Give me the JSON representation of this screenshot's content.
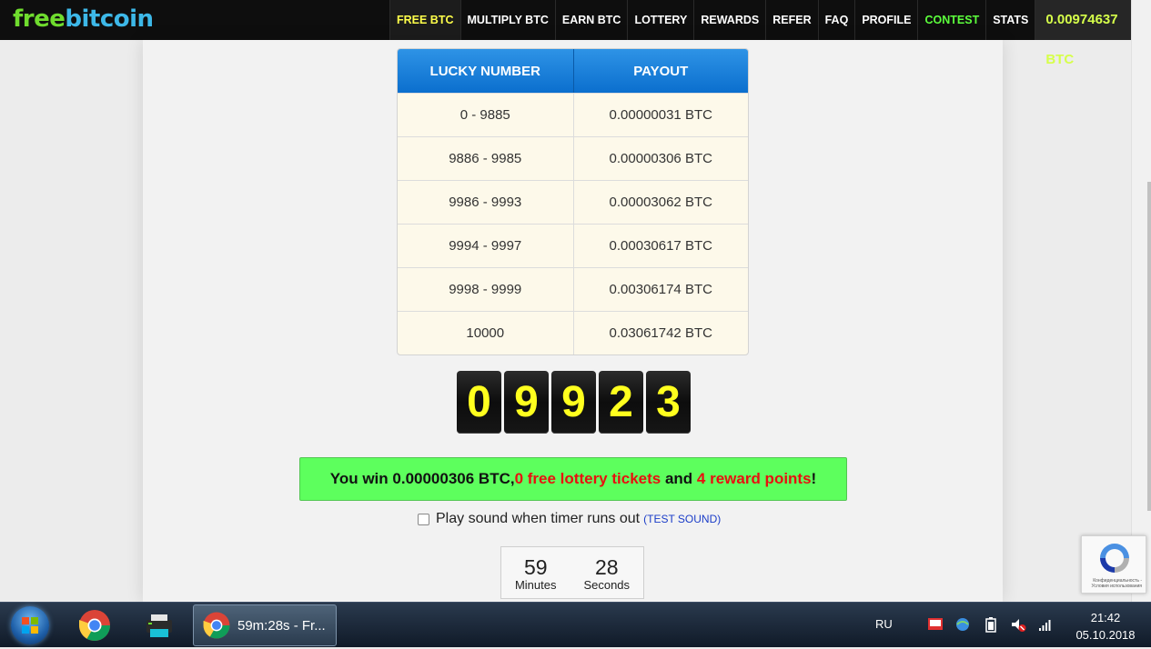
{
  "header": {
    "logo_part1": "free",
    "logo_part2": "bitcoin",
    "nav": [
      {
        "label": "FREE BTC",
        "active": true
      },
      {
        "label": "MULTIPLY BTC"
      },
      {
        "label": "EARN BTC"
      },
      {
        "label": "LOTTERY"
      },
      {
        "label": "REWARDS"
      },
      {
        "label": "REFER"
      },
      {
        "label": "FAQ"
      },
      {
        "label": "PROFILE"
      },
      {
        "label": "CONTEST"
      },
      {
        "label": "STATS"
      }
    ],
    "balance": "0.00974637 BTC",
    "power_icon": "power-icon"
  },
  "payout_table": {
    "headers": [
      "LUCKY NUMBER",
      "PAYOUT"
    ],
    "rows": [
      [
        "0 - 9885",
        "0.00000031 BTC"
      ],
      [
        "9886 - 9985",
        "0.00000306 BTC"
      ],
      [
        "9986 - 9993",
        "0.00003062 BTC"
      ],
      [
        "9994 - 9997",
        "0.00030617 BTC"
      ],
      [
        "9998 - 9999",
        "0.00306174 BTC"
      ],
      [
        "10000",
        "0.03061742 BTC"
      ]
    ]
  },
  "roll_digits": [
    "0",
    "9",
    "9",
    "2",
    "3"
  ],
  "win_message": {
    "part1": "You win 0.00000306 BTC, ",
    "tickets": "0 free lottery tickets",
    "part2": " and ",
    "points": "4 reward points",
    "part3": "!"
  },
  "sound": {
    "label": "Play sound when timer runs out",
    "test_link": "(TEST SOUND)",
    "checked": false
  },
  "timer": {
    "minutes": "59",
    "minutes_label": "Minutes",
    "seconds": "28",
    "seconds_label": "Seconds"
  },
  "recaptcha": {
    "text": "Конфиденциальность - Условия использования"
  },
  "taskbar": {
    "task_title": "59m:28s - Fr...",
    "language": "RU",
    "time": "21:42",
    "date": "05.10.2018"
  },
  "colors": {
    "accent_blue": "#0b6fce",
    "win_green": "#5dff5d",
    "digit_yellow": "#ffff1e",
    "nav_active": "#ffff4a",
    "contest_green": "#5cff3c",
    "balance": "#d6ff4a"
  }
}
